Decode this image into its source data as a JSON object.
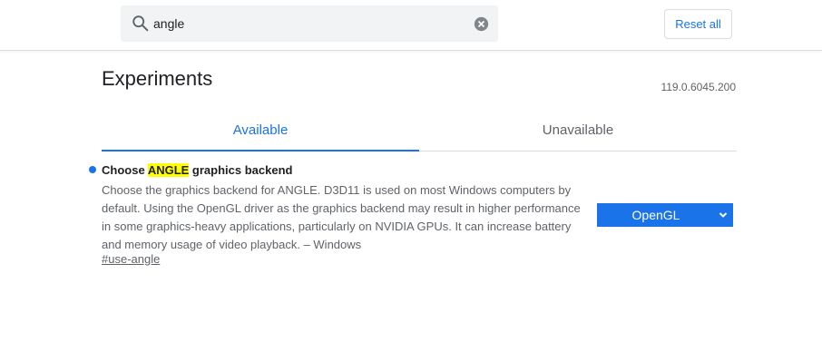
{
  "search": {
    "value": "angle",
    "icon": "search-icon",
    "clear_icon": "clear-icon"
  },
  "header": {
    "reset_label": "Reset all"
  },
  "page": {
    "title": "Experiments",
    "version": "119.0.6045.200"
  },
  "tabs": [
    {
      "label": "Available",
      "active": true
    },
    {
      "label": "Unavailable",
      "active": false
    }
  ],
  "experiment": {
    "title_prefix": "Choose ",
    "title_highlight": "ANGLE",
    "title_suffix": " graphics backend",
    "description": "Choose the graphics backend for ANGLE. D3D11 is used on most Windows computers by default. Using the OpenGL driver as the graphics backend may result in higher performance in some graphics-heavy applications, particularly on NVIDIA GPUs. It can increase battery and memory usage of video playback. – Windows",
    "link": "#use-angle",
    "selected_option": "OpenGL"
  },
  "colors": {
    "accent": "#1a73e8",
    "highlight": "#ffff00",
    "text_secondary": "#5f6368"
  }
}
